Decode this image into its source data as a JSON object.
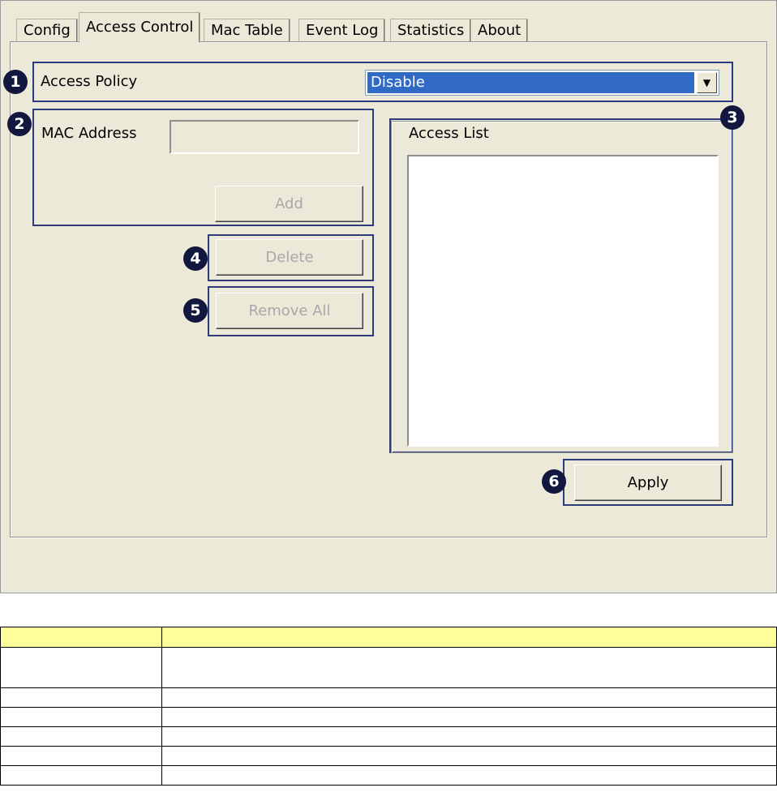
{
  "tabs": [
    {
      "label": "Config",
      "active": false
    },
    {
      "label": "Access Control",
      "active": true
    },
    {
      "label": "Mac Table",
      "active": false
    },
    {
      "label": "Event Log",
      "active": false
    },
    {
      "label": "Statistics",
      "active": false
    },
    {
      "label": "About",
      "active": false
    }
  ],
  "access_policy": {
    "label": "Access Policy",
    "value": "Disable"
  },
  "mac_address": {
    "label": "MAC Address",
    "value": ""
  },
  "access_list": {
    "label": "Access List",
    "items": []
  },
  "buttons": {
    "add": "Add",
    "delete": "Delete",
    "remove_all": "Remove All",
    "apply": "Apply"
  },
  "badges": [
    "1",
    "2",
    "3",
    "4",
    "5",
    "6"
  ],
  "colors": {
    "highlight_border": "#2d3b7a",
    "badge": "#12173f",
    "selection": "#316ac5",
    "table_header": "#ffff99"
  }
}
